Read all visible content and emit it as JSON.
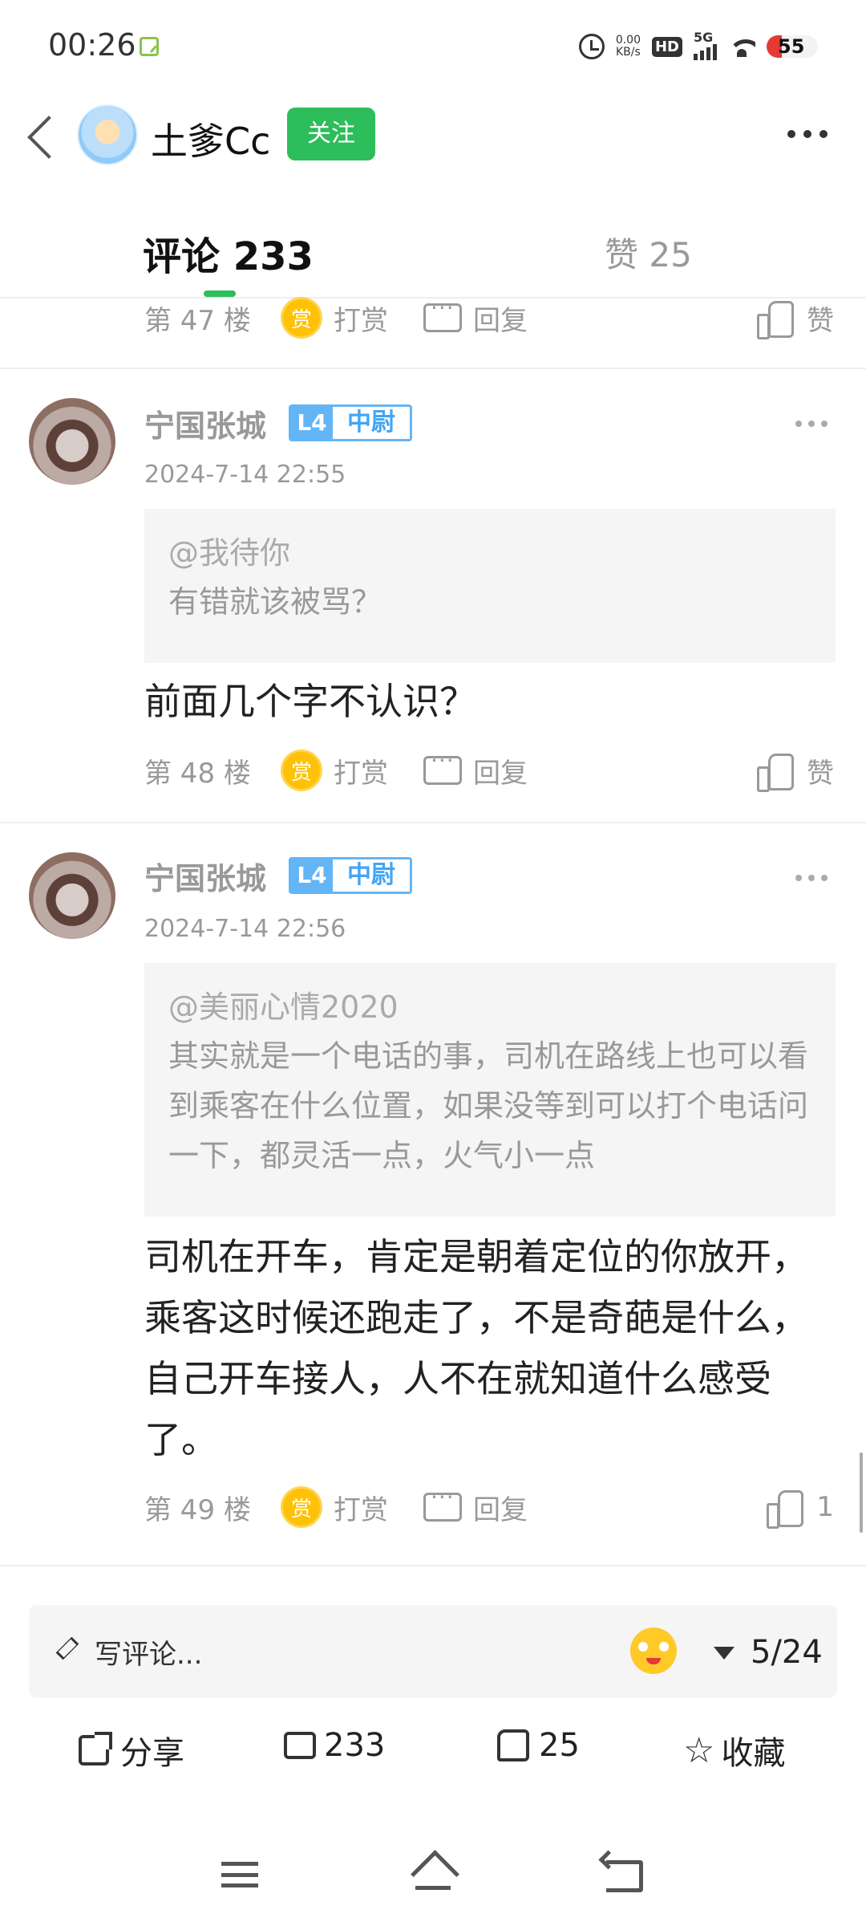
{
  "status_bar": {
    "time": "00:26",
    "net_speed": "0.00",
    "net_unit": "KB/s",
    "hd": "HD",
    "signal": "5G",
    "battery": "55"
  },
  "header": {
    "username": "土爹Cc",
    "follow_label": "关注"
  },
  "tabs": {
    "comments": "评论 233",
    "likes": "赞 25"
  },
  "labels": {
    "reward": "打赏",
    "reward_coin": "赏",
    "reply": "回复",
    "like": "赞"
  },
  "comments": [
    {
      "floor": "第 47 楼",
      "like": "赞"
    },
    {
      "author": "宁国张城",
      "level": "L4",
      "rank": "中尉",
      "time": "2024-7-14 22:55",
      "quote_user": "@我待你",
      "quote_text": "有错就该被骂？",
      "body": "前面几个字不认识？",
      "floor": "第 48 楼",
      "like": "赞"
    },
    {
      "author": "宁国张城",
      "level": "L4",
      "rank": "中尉",
      "time": "2024-7-14 22:56",
      "quote_user": "@美丽心情2020",
      "quote_text": "其实就是一个电话的事，司机在路线上也可以看到乘客在什么位置，如果没等到可以打个电话问一下，都灵活一点，火气小一点",
      "body": "司机在开车，肯定是朝着定位的你放开，乘客这时候还跑走了，不是奇葩是什么，自己开车接人，人不在就知道什么感受了。",
      "floor": "第 49 楼",
      "like": "1"
    }
  ],
  "input": {
    "placeholder": "写评论...",
    "page": "5/24"
  },
  "bottom_actions": {
    "share": "分享",
    "comments": "233",
    "likes": "25",
    "favorite": "收藏"
  },
  "colors": {
    "accent": "#2dbd5a",
    "badge": "#64b5f6",
    "coin": "#ffc107"
  }
}
